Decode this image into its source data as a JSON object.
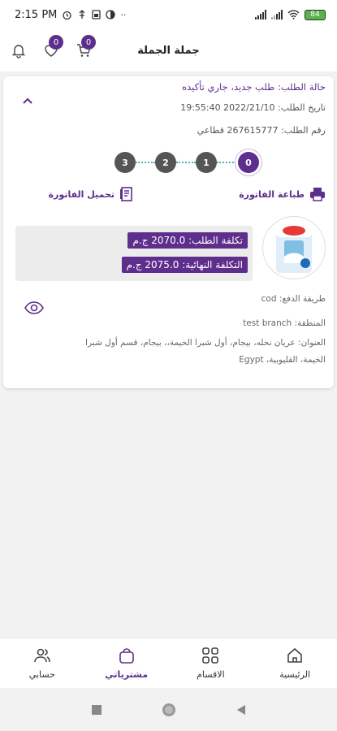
{
  "status_bar": {
    "time": "2:15 PM",
    "icons": [
      "alarm-icon",
      "usb-icon",
      "sim-icon",
      "data-saver-icon",
      "more-dots-icon"
    ],
    "battery": "84"
  },
  "header": {
    "title": "جملة الجملة",
    "notifications_icon": "bell-icon",
    "favorites_count": "0",
    "cart_count": "0"
  },
  "order": {
    "status": "حالة الطلب: طلب جديد، جاري تأكيده",
    "date": "تاريخ الطلب: 2022/21/10 19:55:40",
    "number": "رقم الطلب: 267615777 قطاعي",
    "steps": [
      "0",
      "1",
      "2",
      "3"
    ],
    "active_step": "0",
    "print_invoice": "طباعة الفاتورة",
    "download_invoice": "تحميل الفاتورة",
    "order_cost": "تكلفة الطلب: 2070.0 ج.م",
    "final_cost": "التكلفة النهائية: 2075.0 ج.م",
    "payment_method": "طريقة الدفع: cod",
    "region": "المنطقة: test branch",
    "address": "العنوان: عريان نخله، بيجام، أول شبرا الخيمة،، بيجام، قسم أول شبرا الخيمة، القليوبية، Egypt"
  },
  "bottom_nav": {
    "home": "الرئيسية",
    "categories": "الاقسام",
    "orders": "مشترياتي",
    "account": "حسابي"
  },
  "colors": {
    "accent": "#5d2e8c",
    "step_line": "#4fb3b3"
  }
}
